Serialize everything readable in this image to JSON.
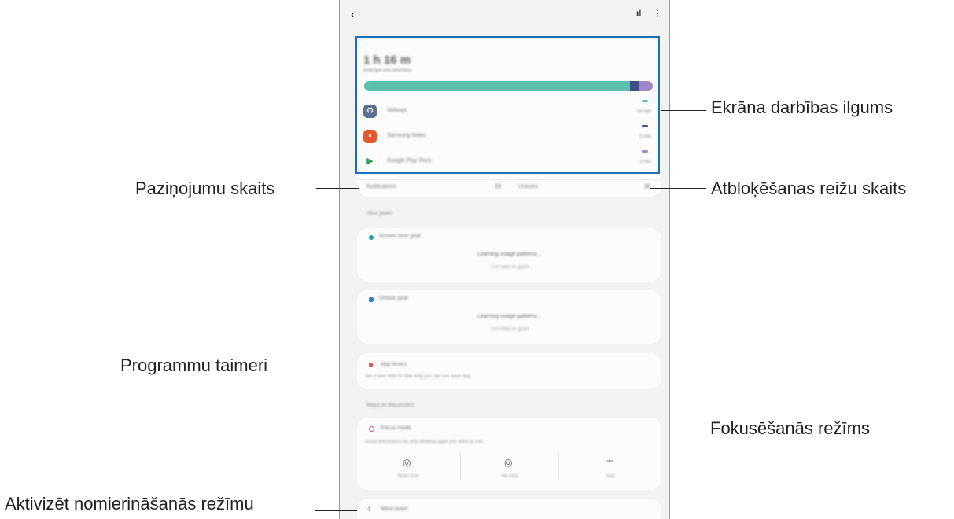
{
  "callouts": {
    "screen_time": "Ekrāna darbības ilgums",
    "notifications": "Paziņojumu skaits",
    "unlocks": "Atbloķēšanas reižu skaits",
    "app_timers": "Programmu taimeri",
    "focus_mode": "Fokusēšanās režīms",
    "wind_down": "Aktivizēt nomierināšanās režīmu"
  },
  "phone": {
    "back_icon": "‹",
    "signal_icon": "ııl",
    "more_icon": "⋮",
    "summary": {
      "total_time": "1 h 16 m",
      "subtitle": "Ievērojot visu lietošanu",
      "bar_segments": [
        {
          "color": "#5cbfae",
          "fraction": 0.92
        },
        {
          "color": "#3f4d86",
          "fraction": 0.035
        },
        {
          "color": "#9f86c9",
          "fraction": 0.045
        }
      ],
      "apps": [
        {
          "name": "Settings",
          "time": "54 min",
          "icon": "⚙",
          "icon_color": "#5b6f8e",
          "mark_color": "#5cbfae"
        },
        {
          "name": "Samsung Notes",
          "time": "5 min",
          "icon": "▪",
          "icon_color": "#e3592c",
          "mark_color": "#3f4d86"
        },
        {
          "name": "Google Play Store",
          "time": "3 min",
          "icon": "▶",
          "icon_color": "#ffffff",
          "mark_color": "#9f86c9"
        }
      ],
      "notifications_label": "Notifications",
      "notifications_value": "23",
      "unlocks_label": "Unlocks",
      "unlocks_value": "30"
    },
    "goals_label": "Your goals",
    "screen_goal": {
      "title": "Screen time goal",
      "status": "Learning usage patterns...",
      "hint": "Turn data on goals"
    },
    "unlock_goal": {
      "title": "Unlock goal",
      "status": "Learning usage patterns...",
      "hint": "Turn data on goals"
    },
    "app_timers": {
      "title": "App timers",
      "desc": "Set a time limit for how long you can use each app."
    },
    "disconnect_label": "Ways to disconnect",
    "focus_mode": {
      "title": "Focus mode",
      "desc": "Avoid distractions by only allowing apps you want to use.",
      "options": [
        "Work time",
        "Me time",
        "Add"
      ]
    },
    "wind_down": {
      "title": "Wind down"
    }
  }
}
